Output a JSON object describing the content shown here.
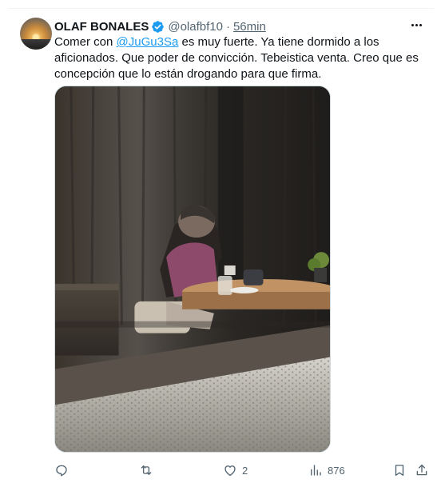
{
  "tweet": {
    "author": {
      "name": "OLAF BONALES",
      "handle": "@olafbf10",
      "separator": "·",
      "time": "56min"
    },
    "text": {
      "before": "Comer con ",
      "mention": "@JuGu3Sa",
      "after": " es muy fuerte. Ya tiene dormido a los aficionados. Que poder de convicción. Tebeistica venta. Creo que es concepción que lo están drogando para que firma."
    },
    "media": {
      "alt": "Imagen"
    },
    "actions": {
      "reply_count": "",
      "retweet_count": "",
      "like_count": "2",
      "view_count": "876"
    }
  },
  "colors": {
    "accent": "#1d9bf0",
    "text_secondary": "#536471",
    "text_primary": "#0f1419"
  },
  "icons": [
    "verified-badge-icon",
    "more-options-icon",
    "reply-icon",
    "retweet-icon",
    "like-icon",
    "views-icon",
    "bookmark-icon",
    "share-icon"
  ]
}
